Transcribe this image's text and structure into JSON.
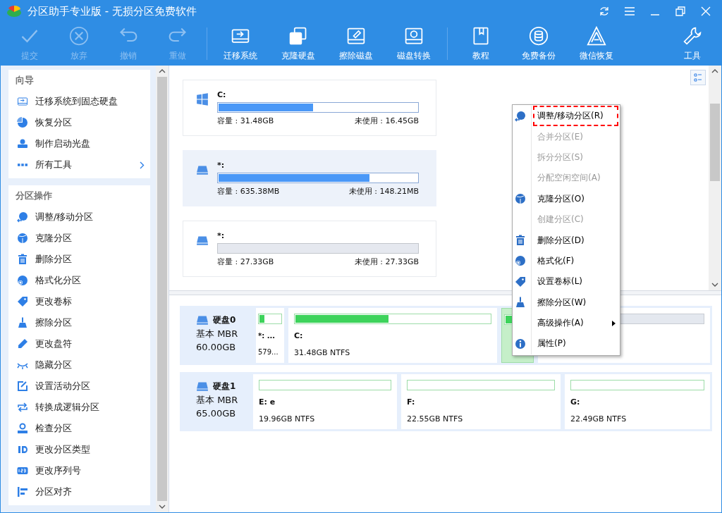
{
  "window": {
    "title": "分区助手专业版 - 无损分区免费软件"
  },
  "toolbar": [
    {
      "label": "提交",
      "disabled": true
    },
    {
      "label": "放弃",
      "disabled": true
    },
    {
      "label": "撤销",
      "disabled": true
    },
    {
      "label": "重做",
      "disabled": true
    },
    {
      "label": "迁移系统",
      "disabled": false
    },
    {
      "label": "克隆硬盘",
      "disabled": false
    },
    {
      "label": "擦除磁盘",
      "disabled": false
    },
    {
      "label": "磁盘转换",
      "disabled": false
    },
    {
      "label": "教程",
      "disabled": false
    },
    {
      "label": "免费备份",
      "disabled": false
    },
    {
      "label": "微信恢复",
      "disabled": false
    },
    {
      "label": "工具",
      "disabled": false
    }
  ],
  "sidebar": {
    "sections": [
      {
        "title": "向导",
        "items": [
          {
            "label": "迁移系统到固态硬盘",
            "submenu": false
          },
          {
            "label": "恢复分区",
            "submenu": false
          },
          {
            "label": "制作启动光盘",
            "submenu": false
          },
          {
            "label": "所有工具",
            "submenu": true
          }
        ]
      },
      {
        "title": "分区操作",
        "items": [
          {
            "label": "调整/移动分区",
            "submenu": false
          },
          {
            "label": "克隆分区",
            "submenu": false
          },
          {
            "label": "删除分区",
            "submenu": false
          },
          {
            "label": "格式化分区",
            "submenu": false
          },
          {
            "label": "更改卷标",
            "submenu": false
          },
          {
            "label": "擦除分区",
            "submenu": false
          },
          {
            "label": "更改盘符",
            "submenu": false
          },
          {
            "label": "隐藏分区",
            "submenu": false
          },
          {
            "label": "设置活动分区",
            "submenu": false
          },
          {
            "label": "转换成逻辑分区",
            "submenu": false
          },
          {
            "label": "检查分区",
            "submenu": false
          },
          {
            "label": "更改分区类型",
            "submenu": false
          },
          {
            "label": "更改序列号",
            "submenu": false
          },
          {
            "label": "分区对齐",
            "submenu": false
          }
        ]
      }
    ]
  },
  "partitions": [
    {
      "kind": "system",
      "name": "C:",
      "capacity": "容量 : 31.48GB",
      "free": "未使用 : 16.45GB",
      "level": 0.475,
      "selected": false
    },
    {
      "kind": "data",
      "name": "*:",
      "capacity": "容量 : 635.38MB",
      "free": "未使用 : 148.21MB",
      "level": 0.76,
      "selected": true
    },
    {
      "kind": "unallocated",
      "name": "*:",
      "capacity": "容量 : 27.33GB",
      "free": "未使用 : 27.33GB",
      "selected": false
    }
  ],
  "disks": [
    {
      "name": "硬盘0",
      "type": "基本 MBR",
      "size": "60.00GB",
      "partitions": [
        {
          "kind": "ntfs",
          "name": "*: ...",
          "info": "579...",
          "level": 0.22,
          "selected": false
        },
        {
          "kind": "ntfs",
          "name": "C:",
          "info": "31.48GB NTFS",
          "level": 0.48,
          "selected": false
        },
        {
          "kind": "ntfs",
          "level": 0.3,
          "selected": true
        },
        {
          "kind": "unallocated",
          "selected": false
        }
      ]
    },
    {
      "name": "硬盘1",
      "type": "基本 MBR",
      "size": "65.00GB",
      "partitions": [
        {
          "kind": "ntfs",
          "name": "E: e",
          "info": "19.96GB NTFS",
          "selected": false
        },
        {
          "kind": "ntfs",
          "name": "F:",
          "info": "22.55GB NTFS",
          "selected": false
        },
        {
          "kind": "ntfs",
          "name": "G:",
          "info": "22.49GB NTFS",
          "selected": false
        }
      ]
    }
  ],
  "context_menu": [
    {
      "label": "调整/移动分区(R)",
      "disabled": false,
      "highlighted": true,
      "submenu": false
    },
    {
      "label": "合并分区(E)",
      "disabled": true,
      "highlighted": false,
      "submenu": false
    },
    {
      "label": "拆分分区(S)",
      "disabled": true,
      "highlighted": false,
      "submenu": false
    },
    {
      "label": "分配空闲空间(A)",
      "disabled": true,
      "highlighted": false,
      "submenu": false
    },
    {
      "label": "克隆分区(O)",
      "disabled": false,
      "highlighted": false,
      "submenu": false
    },
    {
      "label": "创建分区(C)",
      "disabled": true,
      "highlighted": false,
      "submenu": false
    },
    {
      "label": "删除分区(D)",
      "disabled": false,
      "highlighted": false,
      "submenu": false
    },
    {
      "label": "格式化(F)",
      "disabled": false,
      "highlighted": false,
      "submenu": false
    },
    {
      "label": "设置卷标(L)",
      "disabled": false,
      "highlighted": false,
      "submenu": false
    },
    {
      "label": "擦除分区(W)",
      "disabled": false,
      "highlighted": false,
      "submenu": false
    },
    {
      "label": "高级操作(A)",
      "disabled": false,
      "highlighted": false,
      "submenu": true
    },
    {
      "label": "属性(P)",
      "disabled": false,
      "highlighted": false,
      "submenu": false
    }
  ]
}
